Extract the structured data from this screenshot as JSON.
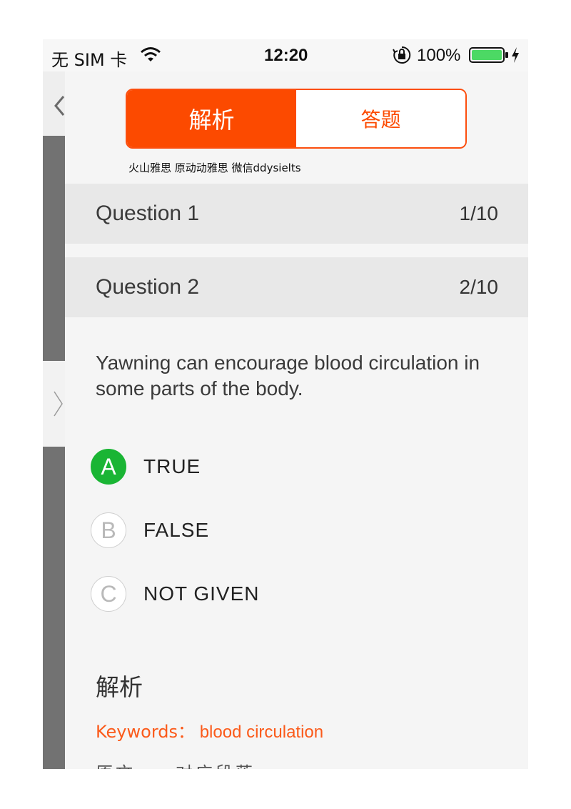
{
  "status_bar": {
    "carrier": "无 SIM 卡",
    "time": "12:20",
    "battery_percent": "100%",
    "icons": [
      "wifi-icon",
      "orientation-lock-icon",
      "battery-icon",
      "charging-icon"
    ],
    "battery_color": "#4cd964"
  },
  "tabs": {
    "analysis_label": "解析",
    "answer_label": "答题",
    "accent_color": "#fc4a00"
  },
  "watermark": "火山雅思 原动动雅思 微信ddysielts",
  "questions": [
    {
      "title": "Question 1",
      "count": "1/10"
    },
    {
      "title": "Question 2",
      "count": "2/10"
    }
  ],
  "question_text": "Yawning can encourage blood circulation in some parts of the body.",
  "options": [
    {
      "letter": "A",
      "text": "TRUE",
      "correct": true
    },
    {
      "letter": "B",
      "text": "FALSE",
      "correct": false
    },
    {
      "letter": "C",
      "text": "NOT GIVEN",
      "correct": false
    }
  ],
  "correct_color": "#1ab534",
  "analysis": {
    "title": "解析",
    "keywords_label": "Keywords：",
    "keywords_value": "blood circulation"
  }
}
